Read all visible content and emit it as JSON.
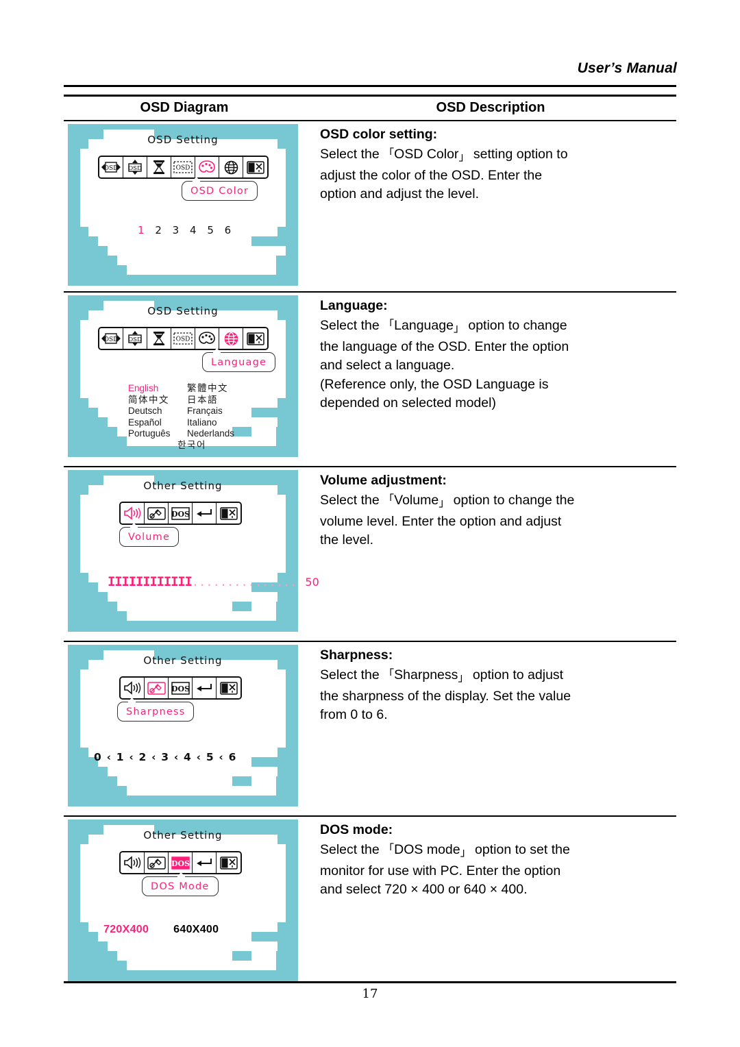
{
  "header": {
    "manual_title": "User’s Manual"
  },
  "footer": {
    "page_number": "17"
  },
  "table": {
    "columns": {
      "diagram": "OSD Diagram",
      "description": "OSD Description"
    },
    "rows": [
      {
        "id": "osd-color",
        "diagram": {
          "menu_title": "OSD Setting",
          "icons": [
            "osd-h-position-icon",
            "osd-v-position-icon",
            "osd-timer-icon",
            "osd-transparency-icon",
            "osd-color-icon",
            "osd-language-icon",
            "osd-exit-icon"
          ],
          "selected_icon_index": 4,
          "tooltip": "OSD Color",
          "values": [
            "1",
            "2",
            "3",
            "4",
            "5",
            "6"
          ],
          "selected_value": "1"
        },
        "description": {
          "title": "OSD color setting:",
          "lines": [
            {
              "pre": "Select the ",
              "quoted": "OSD Color",
              "post": " setting option to"
            },
            {
              "plain": "adjust the color of the OSD. Enter the"
            },
            {
              "plain": "option and adjust the level."
            }
          ]
        }
      },
      {
        "id": "language",
        "diagram": {
          "menu_title": "OSD Setting",
          "icons": [
            "osd-h-position-icon",
            "osd-v-position-icon",
            "osd-timer-icon",
            "osd-transparency-icon",
            "osd-color-icon",
            "osd-language-icon",
            "osd-exit-icon"
          ],
          "selected_icon_index": 5,
          "tooltip": "Language",
          "languages": [
            [
              "English",
              "繁體中文"
            ],
            [
              "简体中文",
              "日本語"
            ],
            [
              "Deutsch",
              "Français"
            ],
            [
              "Español",
              "Italiano"
            ],
            [
              "Português",
              "Nederlands"
            ]
          ],
          "language_last": "한국어",
          "selected_language": "English"
        },
        "description": {
          "title": "Language:",
          "lines": [
            {
              "pre": "Select the ",
              "quoted": "Language",
              "post": " option to change"
            },
            {
              "plain": "the language of the OSD. Enter the option"
            },
            {
              "plain": "and select a language."
            },
            {
              "plain": "(Reference only, the OSD Language is"
            },
            {
              "plain": "depended on selected model)"
            }
          ]
        }
      },
      {
        "id": "volume",
        "diagram": {
          "menu_title": "Other Setting",
          "icons": [
            "volume-icon",
            "sharpness-icon",
            "dos-mode-icon",
            "return-icon",
            "exit-icon"
          ],
          "selected_icon_index": 0,
          "tooltip": "Volume",
          "bar_filled": "IIIIIIIIIIII",
          "bar_empty": "...............",
          "value": "50"
        },
        "description": {
          "title": "Volume adjustment:",
          "lines": [
            {
              "pre": "Select the ",
              "quoted": "Volume",
              "post": " option to change the"
            },
            {
              "plain": "volume level. Enter the option and adjust"
            },
            {
              "plain": "the level."
            }
          ]
        }
      },
      {
        "id": "sharpness",
        "diagram": {
          "menu_title": "Other Setting",
          "icons": [
            "volume-icon",
            "sharpness-icon",
            "dos-mode-icon",
            "return-icon",
            "exit-icon"
          ],
          "selected_icon_index": 1,
          "tooltip": "Sharpness",
          "scale": "0 ‹ 1 ‹ 2 ‹ 3 ‹ 4 ‹ 5 ‹ 6"
        },
        "description": {
          "title": "Sharpness:",
          "lines": [
            {
              "pre": "Select the ",
              "quoted": "Sharpness",
              "post": " option to adjust"
            },
            {
              "plain": "the sharpness of the display. Set the value"
            },
            {
              "plain": "from 0 to 6."
            }
          ]
        }
      },
      {
        "id": "dos-mode",
        "diagram": {
          "menu_title": "Other Setting",
          "icons": [
            "volume-icon",
            "sharpness-icon",
            "dos-mode-icon",
            "return-icon",
            "exit-icon"
          ],
          "selected_icon_index": 2,
          "tooltip": "DOS Mode",
          "values": [
            "720X400",
            "640X400"
          ],
          "selected_value": "720X400"
        },
        "description": {
          "title": "DOS mode:",
          "lines": [
            {
              "pre": "Select the ",
              "quoted": "DOS mode",
              "post": " option to set the"
            },
            {
              "plain": "monitor for use with PC. Enter the option"
            },
            {
              "plain": "and select 720 × 400 or 640 × 400."
            }
          ]
        }
      }
    ]
  },
  "colors": {
    "osd_background": "#78C8D4",
    "highlight": "#FF1F7A",
    "rule": "#000000"
  }
}
